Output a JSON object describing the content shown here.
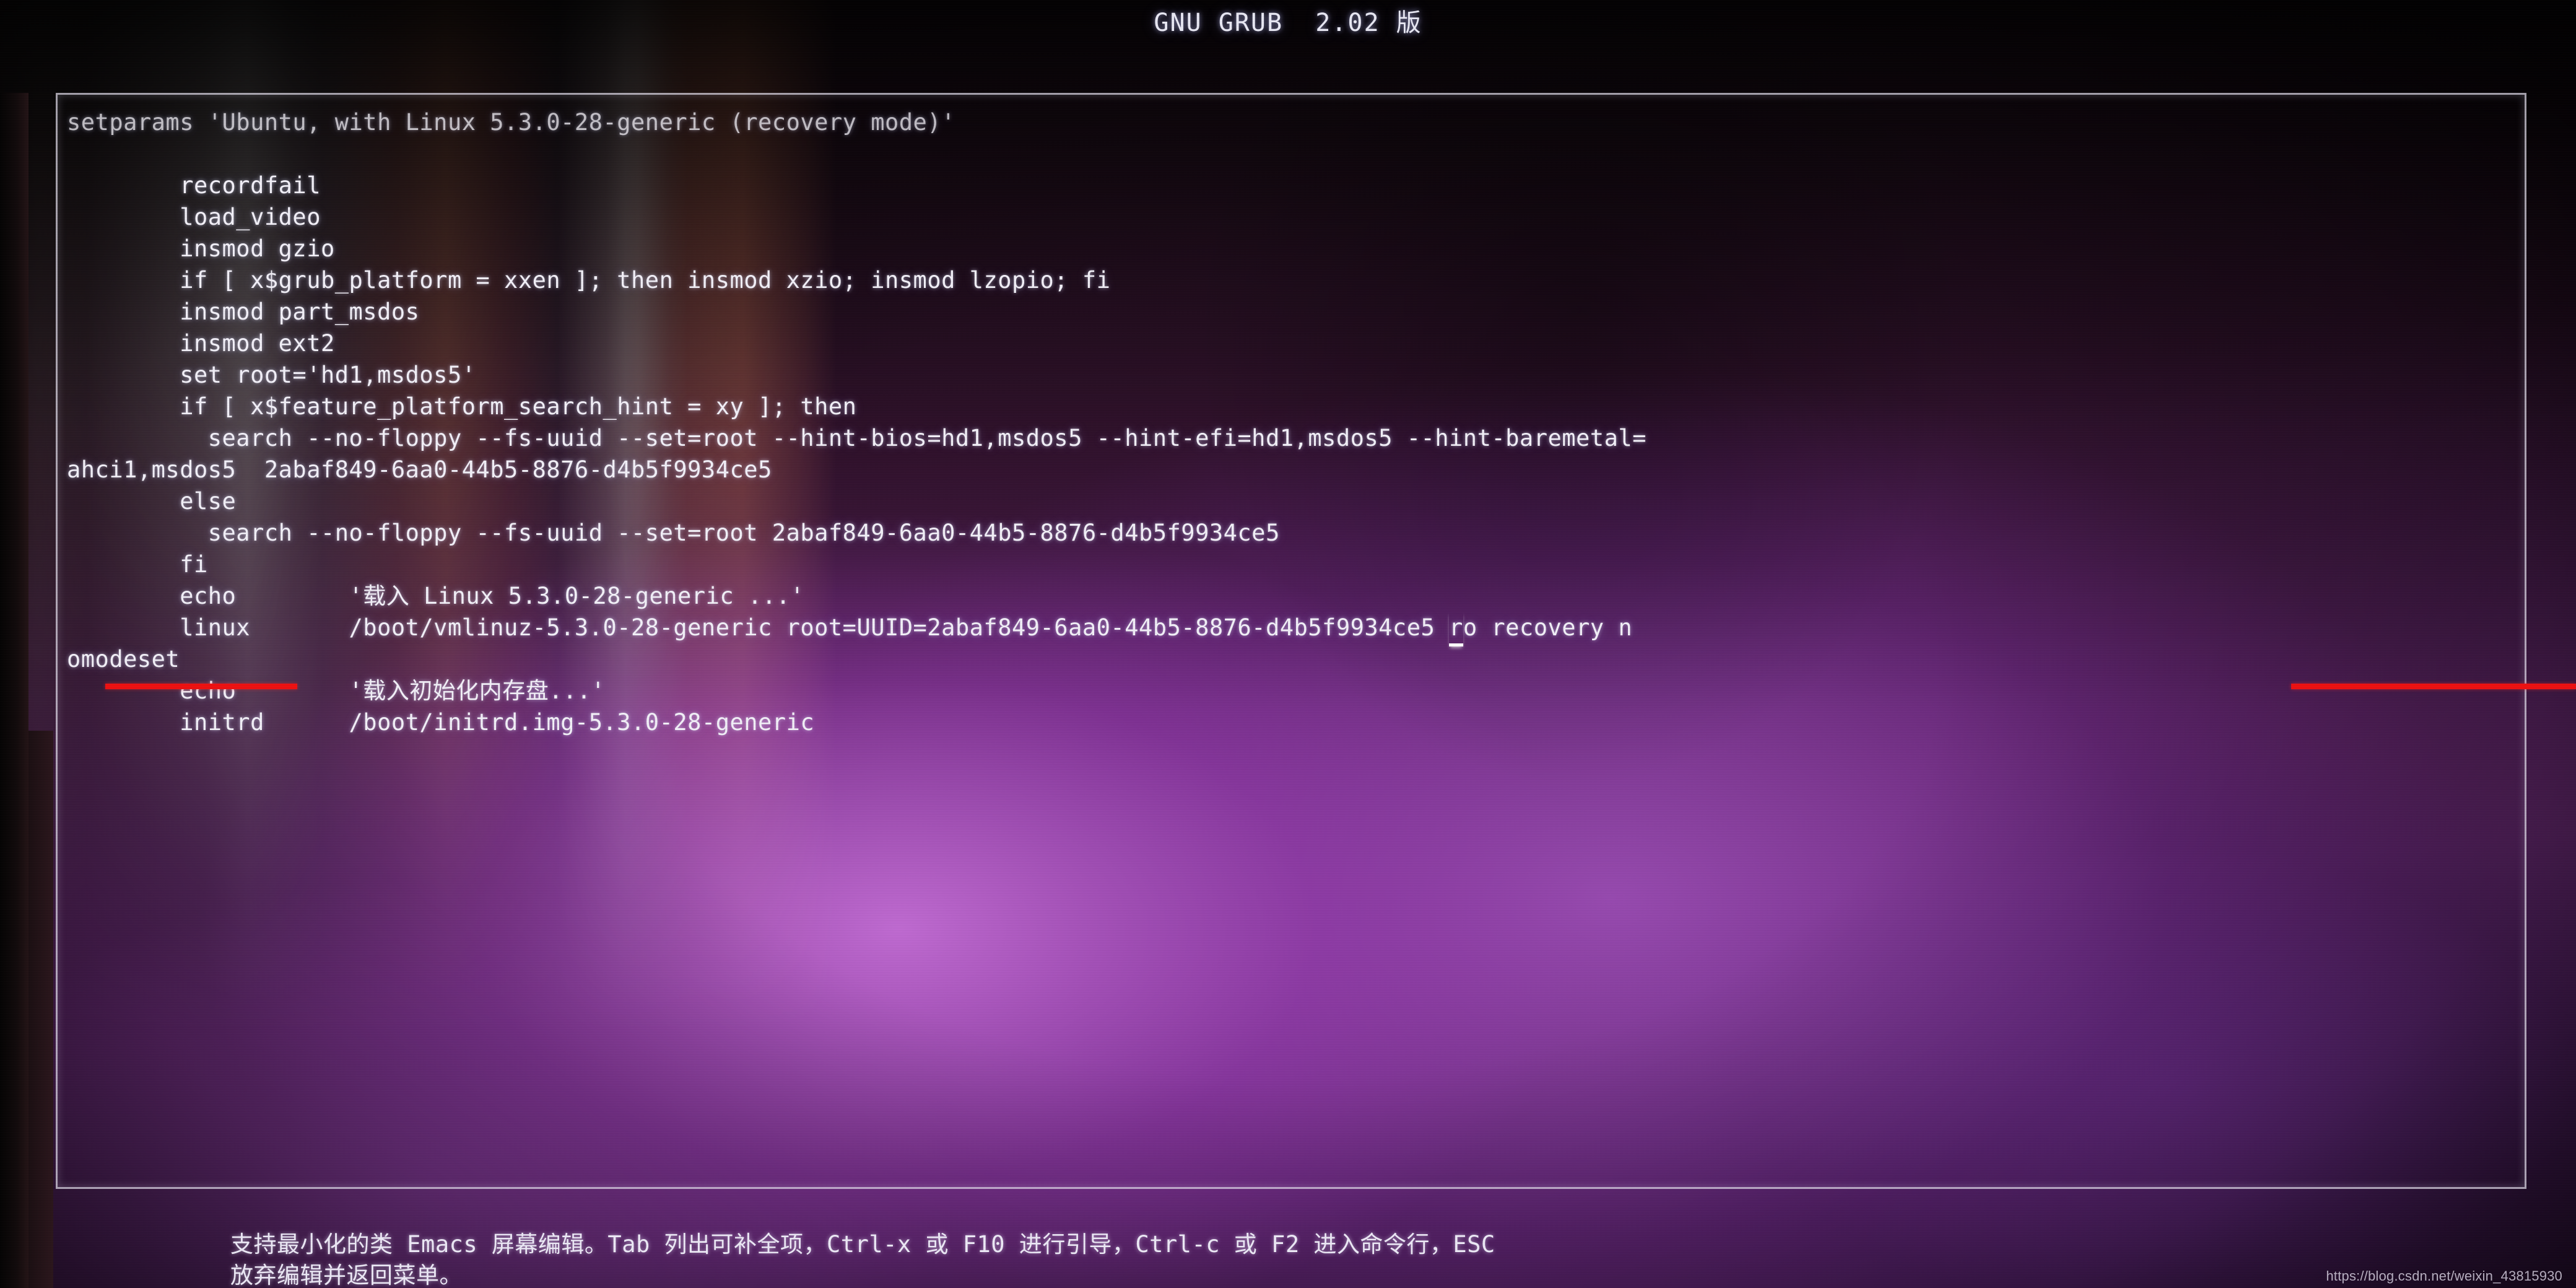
{
  "header": {
    "title": "GNU GRUB  2.02 版"
  },
  "editor": {
    "lines": [
      "setparams 'Ubuntu, with Linux 5.3.0-28-generic (recovery mode)'",
      "",
      "        recordfail",
      "        load_video",
      "        insmod gzio",
      "        if [ x$grub_platform = xxen ]; then insmod xzio; insmod lzopio; fi",
      "        insmod part_msdos",
      "        insmod ext2",
      "        set root='hd1,msdos5'",
      "        if [ x$feature_platform_search_hint = xy ]; then",
      "          search --no-floppy --fs-uuid --set=root --hint-bios=hd1,msdos5 --hint-efi=hd1,msdos5 --hint-baremetal=",
      "ahci1,msdos5  2abaf849-6aa0-44b5-8876-d4b5f9934ce5",
      "        else",
      "          search --no-floppy --fs-uuid --set=root 2abaf849-6aa0-44b5-8876-d4b5f9934ce5",
      "        fi",
      "        echo        '载入 Linux 5.3.0-28-generic ...'",
      "        linux       /boot/vmlinuz-5.3.0-28-generic root=UUID=2abaf849-6aa0-44b5-8876-d4b5f9934ce5 ro recovery n",
      "omodeset",
      "        echo        '载入初始化内存盘...'",
      "        initrd      /boot/initrd.img-5.3.0-28-generic"
    ],
    "cursor_char": "r",
    "cursor_line_index": 16
  },
  "annotations": {
    "underline_color": "#ee1111",
    "left_underline_target": "omodeset",
    "right_underline_target": "ro recovery n"
  },
  "footer": {
    "help_text": "支持最小化的类 Emacs 屏幕编辑。Tab 列出可补全项，Ctrl-x 或 F10 进行引导，Ctrl-c 或 F2 进入命令行，ESC\n放弃编辑并返回菜单。"
  },
  "watermark": {
    "text": "https://blog.csdn.net/weixin_43815930"
  },
  "theme": {
    "background_accent": "#6b2a75",
    "text_color": "#f2f0f8",
    "frame_color": "#e2dee c"
  }
}
